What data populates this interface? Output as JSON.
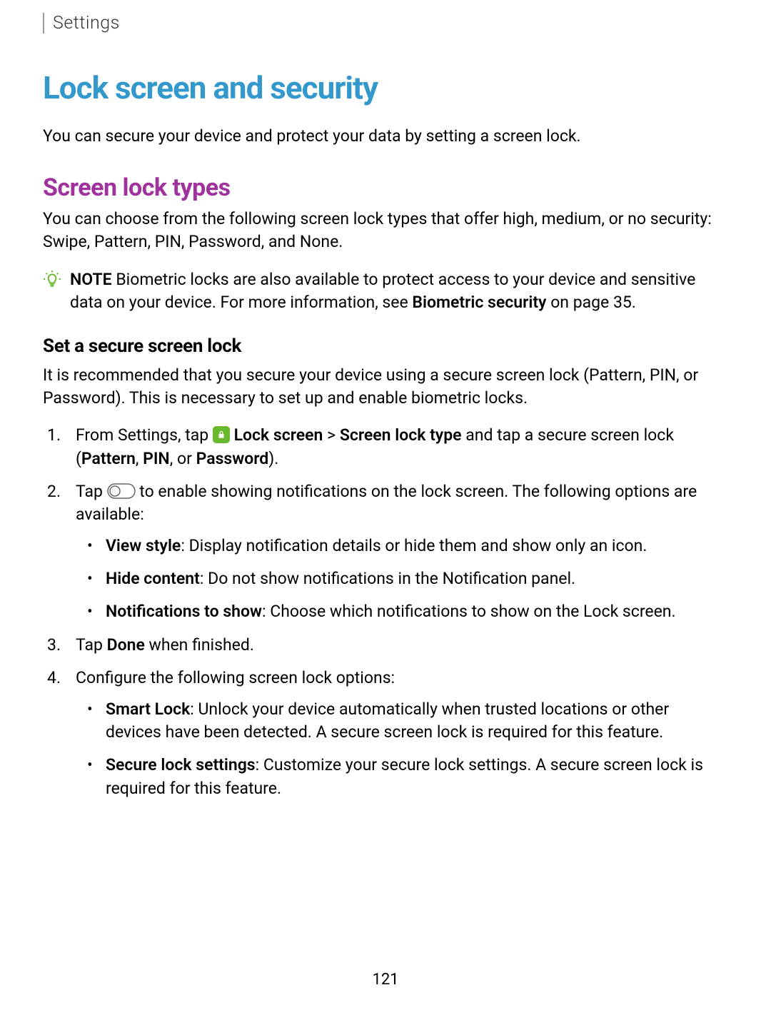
{
  "header": {
    "breadcrumb": "Settings"
  },
  "title": "Lock screen and security",
  "intro": "You can secure your device and protect your data by setting a screen lock.",
  "section1": {
    "heading": "Screen lock types",
    "body": "You can choose from the following screen lock types that offer high, medium, or no security: Swipe, Pattern, PIN, Password, and None.",
    "note_label": "NOTE",
    "note_text_1": " Biometric locks are also available to protect access to your device and sensitive data on your device. For more information, see ",
    "note_link": "Biometric security",
    "note_text_2": " on page 35."
  },
  "section2": {
    "heading": "Set a secure screen lock",
    "body": "It is recommended that you secure your device using a secure screen lock (Pattern, PIN, or Password). This is necessary to set up and enable biometric locks.",
    "step1_pre": "From Settings, tap ",
    "step1_bold1": "Lock screen",
    "step1_mid1": " > ",
    "step1_bold2": "Screen lock type",
    "step1_mid2": " and tap a secure screen lock (",
    "step1_bold3": "Pattern",
    "step1_mid3": ", ",
    "step1_bold4": "PIN",
    "step1_mid4": ", or ",
    "step1_bold5": "Password",
    "step1_end": ").",
    "step2_pre": "Tap ",
    "step2_post": " to enable showing notifications on the lock screen. The following options are available:",
    "step2_sub1_bold": "View style",
    "step2_sub1_text": ": Display notification details or hide them and show only an icon.",
    "step2_sub2_bold": "Hide content",
    "step2_sub2_text": ": Do not show notifications in the Notification panel.",
    "step2_sub3_bold": "Notifications to show",
    "step2_sub3_text": ": Choose which notifications to show on the Lock screen.",
    "step3_pre": "Tap ",
    "step3_bold": "Done",
    "step3_post": " when finished.",
    "step4": "Configure the following screen lock options:",
    "step4_sub1_bold": "Smart Lock",
    "step4_sub1_text": ": Unlock your device automatically when trusted locations or other devices have been detected. A secure screen lock is required for this feature.",
    "step4_sub2_bold": "Secure lock settings",
    "step4_sub2_text": ": Customize your secure lock settings. A secure screen lock is required for this feature."
  },
  "page_number": "121"
}
